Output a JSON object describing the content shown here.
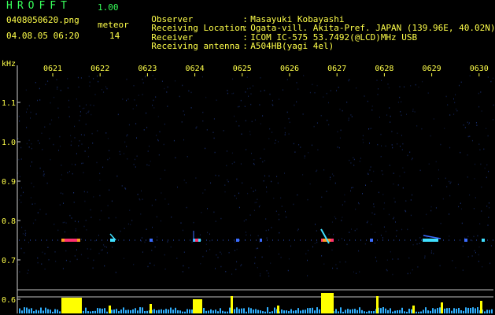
{
  "header": {
    "app_name": "HROFFT",
    "version": "1.00",
    "file_name": "0408050620.png",
    "datetime": "04.08.05 06:20",
    "meteor_label": "meteor",
    "meteor_count": "14"
  },
  "info": [
    {
      "key": "Observer",
      "value": "Masayuki Kobayashi"
    },
    {
      "key": "Receiving Location",
      "value": "Ogata-vill. Akita-Pref. JAPAN (139.96E, 40.02N)"
    },
    {
      "key": "Receiver",
      "value": "ICOM IC-575 53.7492(@LCD)MHz USB"
    },
    {
      "key": "Receiving antenna",
      "value": "A504HB(yagi 4el)"
    }
  ],
  "plot": {
    "y_unit": "kHz",
    "time_labels": [
      "0621",
      "0622",
      "0623",
      "0624",
      "0625",
      "0626",
      "0627",
      "0628",
      "0629",
      "0630"
    ],
    "y_ticks": [
      {
        "label": "1.1",
        "value": 1.1
      },
      {
        "label": "1.0",
        "value": 1.0
      },
      {
        "label": "0.9",
        "value": 0.9
      },
      {
        "label": "0.8",
        "value": 0.8
      },
      {
        "label": "0.7",
        "value": 0.7
      },
      {
        "label": "0.6",
        "value": 0.6
      }
    ],
    "colors": {
      "text": "#ffff4a",
      "title": "#37ff5a",
      "noise": "#1f3a8a",
      "carrier": "#3b6cff",
      "meteor_hot": "#ff3070",
      "meteor_warm": "#ff9a20",
      "meteor_cool": "#40e0ff",
      "activity_bar": "#ffff00",
      "activity_base": "#30b0ff"
    }
  }
}
